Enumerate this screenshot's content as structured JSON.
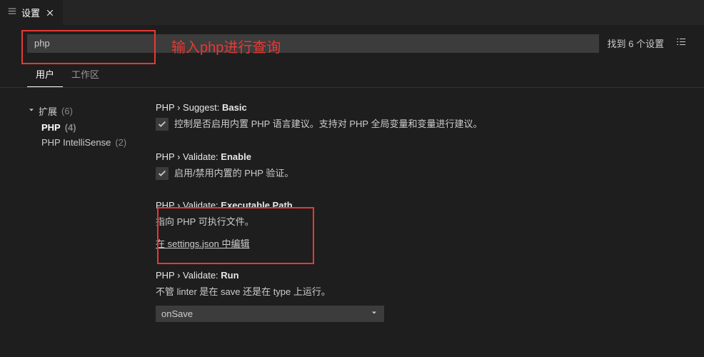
{
  "tab": {
    "title": "设置"
  },
  "search": {
    "value": "php",
    "resultCount": "找到 6 个设置"
  },
  "annotation": {
    "searchHint": "输入php进行查询"
  },
  "scopeTabs": {
    "user": "用户",
    "workspace": "工作区"
  },
  "tree": {
    "root": {
      "label": "扩展",
      "count": "(6)"
    },
    "children": [
      {
        "label": "PHP",
        "count": "(4)"
      },
      {
        "label": "PHP IntelliSense",
        "count": "(2)"
      }
    ]
  },
  "settings": [
    {
      "crumb": "PHP › Suggest: ",
      "name": "Basic",
      "type": "checkbox",
      "checked": true,
      "desc": "控制是否启用内置 PHP 语言建议。支持对 PHP 全局变量和变量进行建议。"
    },
    {
      "crumb": "PHP › Validate: ",
      "name": "Enable",
      "type": "checkbox",
      "checked": true,
      "desc": "启用/禁用内置的 PHP 验证。"
    },
    {
      "crumb": "PHP › Validate: ",
      "name": "Executable Path",
      "type": "link",
      "desc": "指向 PHP 可执行文件。",
      "linkText": "在 settings.json 中编辑"
    },
    {
      "crumb": "PHP › Validate: ",
      "name": "Run",
      "type": "select",
      "desc": "不管 linter 是在 save 还是在 type 上运行。",
      "value": "onSave"
    }
  ]
}
